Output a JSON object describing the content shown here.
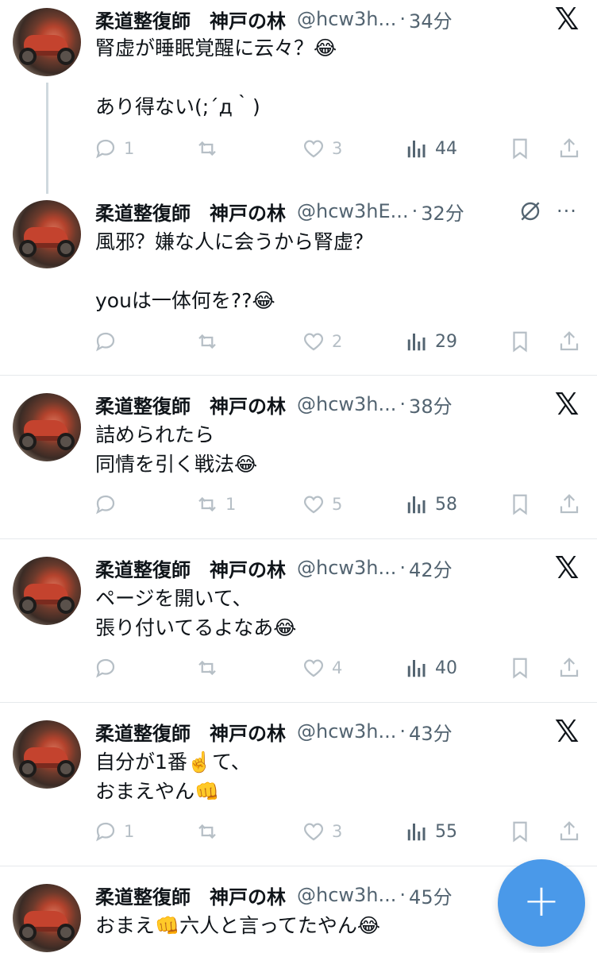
{
  "tweets": [
    {
      "name": "柔道整復師　神戸の林",
      "handle": "@hcw3h...",
      "dot": "·",
      "time": "34分",
      "text": "腎虚が睡眠覚醒に云々？😂\n\nあり得ない(;´д｀)",
      "replies": "1",
      "retweets": "",
      "likes": "3",
      "views": "44",
      "corner_icon": "x-logo-icon"
    },
    {
      "name": "柔道整復師　神戸の林",
      "handle": "@hcw3hE...",
      "dot": "·",
      "time": "32分",
      "text": "風邪？嫌な人に会うから腎虚？\n\nyouは一体何を??😂",
      "replies": "",
      "retweets": "",
      "likes": "2",
      "views": "29",
      "corner_icon": "grok-icon"
    },
    {
      "name": "柔道整復師　神戸の林",
      "handle": "@hcw3h...",
      "dot": "·",
      "time": "38分",
      "text": "詰められたら\n同情を引く戦法😂",
      "replies": "",
      "retweets": "1",
      "likes": "5",
      "views": "58",
      "corner_icon": "x-logo-icon"
    },
    {
      "name": "柔道整復師　神戸の林",
      "handle": "@hcw3h...",
      "dot": "·",
      "time": "42分",
      "text": "ページを開いて、\n張り付いてるよなあ😂",
      "replies": "",
      "retweets": "",
      "likes": "4",
      "views": "40",
      "corner_icon": "x-logo-icon"
    },
    {
      "name": "柔道整復師　神戸の林",
      "handle": "@hcw3h...",
      "dot": "·",
      "time": "43分",
      "text": "自分が1番☝️て、\nおまえやん👊",
      "replies": "1",
      "retweets": "",
      "likes": "3",
      "views": "55",
      "corner_icon": "x-logo-icon"
    },
    {
      "name": "柔道整復師　神戸の林",
      "handle": "@hcw3h...",
      "dot": "·",
      "time": "45分",
      "text": "おまえ👊六人と言ってたやん😂",
      "corner_icon": ""
    }
  ],
  "x_logo": "𝕏",
  "more_dots": "···",
  "fab": {
    "label": "+",
    "icon": "plus-icon",
    "color": "#4a99e9"
  },
  "colors": {
    "text": "#0f1419",
    "muted": "#536471",
    "icon": "#b6bfc6",
    "divider": "#e6e9ec"
  }
}
